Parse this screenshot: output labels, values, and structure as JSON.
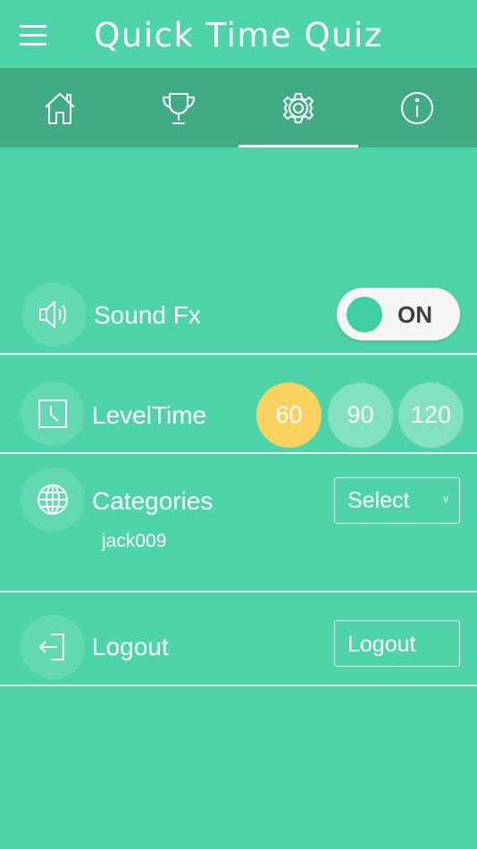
{
  "header": {
    "title": "Quick Time Quiz",
    "menu_icon": "hamburger-menu-icon"
  },
  "tabs": [
    {
      "name": "home",
      "icon": "home-icon",
      "active": false
    },
    {
      "name": "leaderboard",
      "icon": "trophy-icon",
      "active": false
    },
    {
      "name": "settings",
      "icon": "gear-icon",
      "active": true
    },
    {
      "name": "info",
      "icon": "info-icon",
      "active": false
    }
  ],
  "settings": {
    "sound": {
      "label": "Sound Fx",
      "icon": "speaker-icon",
      "toggle_state": "ON"
    },
    "level_time": {
      "label": "LevelTime",
      "icon": "clock-icon",
      "options": [
        "60",
        "90",
        "120"
      ],
      "selected": "60"
    },
    "categories": {
      "label": "Categories",
      "icon": "globe-icon",
      "select_value": "Select",
      "username": "jack009"
    },
    "logout": {
      "label": "Logout",
      "icon": "logout-icon",
      "button_label": "Logout"
    }
  },
  "colors": {
    "background": "#4ed4a8",
    "tabbar": "#41ac84",
    "selected_option": "#fbd15f",
    "toggle_knob": "#3fcfa0"
  }
}
